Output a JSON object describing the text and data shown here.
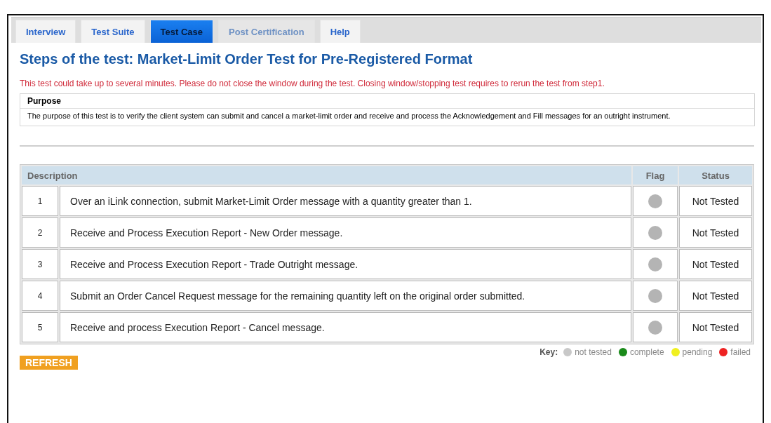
{
  "tabs": [
    {
      "label": "Interview",
      "selected": false,
      "disabled": false
    },
    {
      "label": "Test Suite",
      "selected": false,
      "disabled": false
    },
    {
      "label": "Test Case",
      "selected": true,
      "disabled": false
    },
    {
      "label": "Post Certification",
      "selected": false,
      "disabled": true
    },
    {
      "label": "Help",
      "selected": false,
      "disabled": false
    }
  ],
  "title": "Steps of the test: Market-Limit Order Test for Pre-Registered Format",
  "warning": "This test could take up to several minutes. Please do not close the window during the test. Closing window/stopping test requires to rerun the test from step1.",
  "purpose": {
    "heading": "Purpose",
    "text": "The purpose of this test is to verify the client system can submit and cancel a market-limit order and receive and process the Acknowledgement and Fill messages for an outright instrument."
  },
  "table": {
    "columns": [
      "Description",
      "Flag",
      "Status"
    ],
    "rows": [
      {
        "number": "1",
        "description": "Over an iLink connection, submit Market-Limit Order message with a quantity greater than 1.",
        "color": "#b4b4b4",
        "status": "Not Tested"
      },
      {
        "number": "2",
        "description": "Receive and Process Execution Report - New Order message.",
        "color": "#b4b4b4",
        "status": "Not Tested"
      },
      {
        "number": "3",
        "description": "Receive and Process Execution Report - Trade Outright message.",
        "color": "#b4b4b4",
        "status": "Not Tested"
      },
      {
        "number": "4",
        "description": "Submit an Order Cancel Request message for the remaining quantity left on the original order submitted.",
        "color": "#b4b4b4",
        "status": "Not Tested"
      },
      {
        "number": "5",
        "description": "Receive and process Execution Report - Cancel message.",
        "color": "#b4b4b4",
        "status": "Not Tested"
      }
    ]
  },
  "key": {
    "label": "Key:",
    "items": [
      {
        "label": "not tested",
        "color": "#c8c8c8"
      },
      {
        "label": "complete",
        "color": "#1a8a1a"
      },
      {
        "label": "pending",
        "color": "#f0f020"
      },
      {
        "label": "failed",
        "color": "#ee2222"
      }
    ]
  },
  "refresh_button": "REFRESH"
}
